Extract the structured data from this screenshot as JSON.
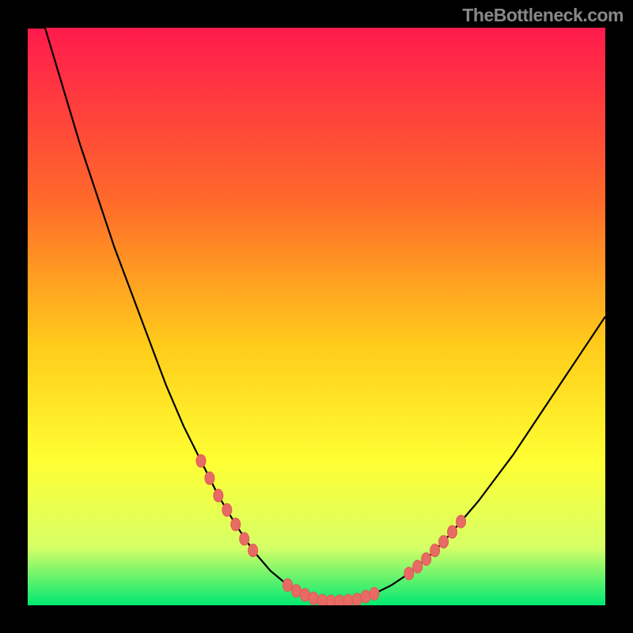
{
  "watermark": "TheBottleneck.com",
  "colors": {
    "page_bg": "#000000",
    "watermark": "#888888",
    "curve": "#000000",
    "marker_fill": "#e86a64",
    "marker_stroke": "#df5a53",
    "grad_top": "#ff1a4d",
    "grad_mid1": "#ff6a2a",
    "grad_mid2": "#ffcc1a",
    "grad_mid3": "#ffff33",
    "grad_low": "#d6ff66",
    "grad_base": "#00e873"
  },
  "chart_data": {
    "type": "line",
    "title": "",
    "xlabel": "",
    "ylabel": "",
    "xlim": [
      0,
      100
    ],
    "ylim": [
      0,
      100
    ],
    "x": [
      0,
      3,
      6,
      9,
      12,
      15,
      18,
      21,
      24,
      27,
      30,
      33,
      36,
      39,
      42,
      45,
      48,
      50,
      52,
      54,
      56,
      58,
      60,
      63,
      66,
      69,
      72,
      75,
      78,
      81,
      84,
      87,
      90,
      93,
      96,
      100
    ],
    "values": [
      140,
      100,
      90,
      80,
      71,
      62,
      54,
      46,
      38,
      31,
      25,
      19,
      14,
      9.5,
      6,
      3.5,
      1.8,
      1.0,
      0.7,
      0.7,
      0.9,
      1.3,
      2.0,
      3.5,
      5.5,
      8,
      11,
      14.5,
      18,
      22,
      26,
      30.5,
      35,
      39.5,
      44,
      50
    ],
    "annotations": {
      "left_cluster_x": [
        30,
        31.5,
        33,
        34.5,
        36,
        37.5,
        39
      ],
      "left_cluster_y": [
        25,
        22,
        19,
        16.5,
        14,
        11.5,
        9.5
      ],
      "valley_cluster_x": [
        45,
        46.5,
        48,
        49.5,
        51,
        52.5,
        54,
        55.5,
        57,
        58.5,
        60
      ],
      "valley_cluster_y": [
        3.5,
        2.5,
        1.8,
        1.2,
        0.8,
        0.7,
        0.7,
        0.8,
        1.0,
        1.5,
        2.0
      ],
      "right_cluster_x": [
        66,
        67.5,
        69,
        70.5,
        72,
        73.5,
        75
      ],
      "right_cluster_y": [
        5.5,
        6.7,
        8,
        9.5,
        11,
        12.7,
        14.5
      ]
    }
  }
}
